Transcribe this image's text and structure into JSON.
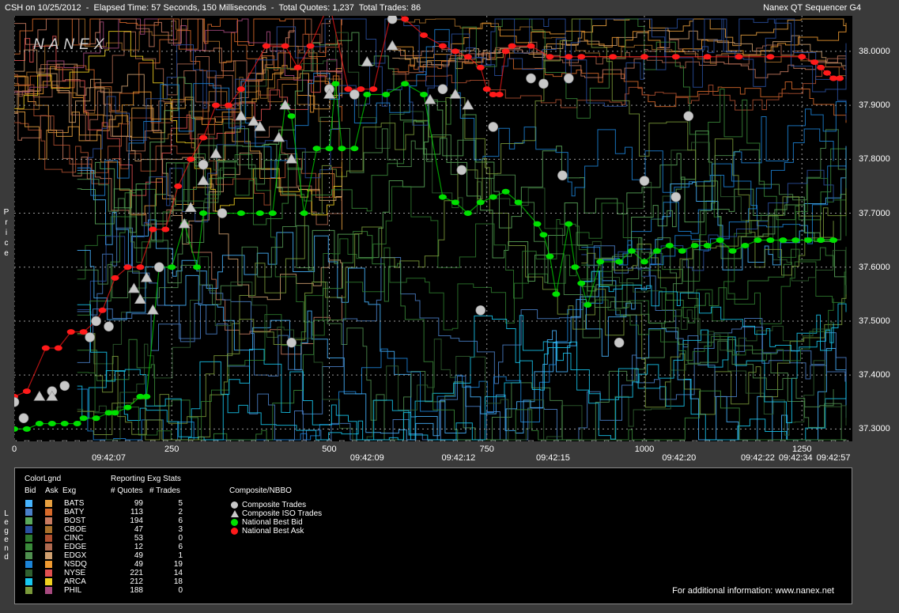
{
  "header": {
    "left": "CSH on 10/25/2012  -  Elapsed Time: 57 Seconds, 150 Milliseconds  -  Total Quotes: 1,237  Total Trades: 86",
    "right": "Nanex QT Sequencer G4",
    "logo": "NANEX",
    "y_axis_title": "Price",
    "legend_side_title": "Legend"
  },
  "chart_data": {
    "type": "scatter",
    "ylim": [
      37.28,
      38.06
    ],
    "xlim": [
      0,
      1320
    ],
    "y_ticks": [
      "37.3000",
      "37.4000",
      "37.5000",
      "37.6000",
      "37.7000",
      "37.8000",
      "37.9000",
      "38.0000"
    ],
    "x_ticks_numeric": [
      "0",
      "250",
      "500",
      "750",
      "1000",
      "1250"
    ],
    "x_ticks_time": [
      {
        "x": 150,
        "label": "09:42:07"
      },
      {
        "x": 560,
        "label": "09:42:09"
      },
      {
        "x": 705,
        "label": "09:42:12"
      },
      {
        "x": 855,
        "label": "09:42:15"
      },
      {
        "x": 1055,
        "label": "09:42:20"
      },
      {
        "x": 1180,
        "label": "09:42:22"
      },
      {
        "x": 1240,
        "label": "09:42:34"
      },
      {
        "x": 1300,
        "label": "09:42:57"
      }
    ],
    "grid": true,
    "series": [
      {
        "name": "National Best Bid",
        "color": "#00e000",
        "points": [
          [
            0,
            37.3
          ],
          [
            20,
            37.3
          ],
          [
            40,
            37.31
          ],
          [
            60,
            37.31
          ],
          [
            80,
            37.31
          ],
          [
            100,
            37.31
          ],
          [
            110,
            37.32
          ],
          [
            130,
            37.32
          ],
          [
            150,
            37.33
          ],
          [
            160,
            37.33
          ],
          [
            180,
            37.34
          ],
          [
            200,
            37.36
          ],
          [
            210,
            37.36
          ],
          [
            230,
            37.6
          ],
          [
            250,
            37.6
          ],
          [
            270,
            37.68
          ],
          [
            290,
            37.6
          ],
          [
            300,
            37.7
          ],
          [
            330,
            37.7
          ],
          [
            360,
            37.7
          ],
          [
            390,
            37.7
          ],
          [
            410,
            37.7
          ],
          [
            430,
            37.9
          ],
          [
            440,
            37.88
          ],
          [
            460,
            37.7
          ],
          [
            480,
            37.82
          ],
          [
            500,
            37.82
          ],
          [
            510,
            37.94
          ],
          [
            520,
            37.82
          ],
          [
            540,
            37.82
          ],
          [
            560,
            37.92
          ],
          [
            590,
            37.92
          ],
          [
            620,
            37.94
          ],
          [
            650,
            37.92
          ],
          [
            680,
            37.73
          ],
          [
            700,
            37.72
          ],
          [
            720,
            37.7
          ],
          [
            740,
            37.72
          ],
          [
            760,
            37.73
          ],
          [
            780,
            37.74
          ],
          [
            800,
            37.72
          ],
          [
            830,
            37.68
          ],
          [
            840,
            37.66
          ],
          [
            850,
            37.62
          ],
          [
            860,
            37.55
          ],
          [
            880,
            37.68
          ],
          [
            890,
            37.6
          ],
          [
            900,
            37.57
          ],
          [
            910,
            37.53
          ],
          [
            930,
            37.61
          ],
          [
            960,
            37.61
          ],
          [
            980,
            37.63
          ],
          [
            1000,
            37.61
          ],
          [
            1020,
            37.63
          ],
          [
            1040,
            37.64
          ],
          [
            1060,
            37.63
          ],
          [
            1080,
            37.64
          ],
          [
            1100,
            37.64
          ],
          [
            1120,
            37.65
          ],
          [
            1140,
            37.63
          ],
          [
            1160,
            37.64
          ],
          [
            1180,
            37.65
          ],
          [
            1200,
            37.65
          ],
          [
            1220,
            37.65
          ],
          [
            1240,
            37.65
          ],
          [
            1260,
            37.65
          ],
          [
            1280,
            37.65
          ],
          [
            1300,
            37.65
          ]
        ]
      },
      {
        "name": "National Best Ask",
        "color": "#ff1a1a",
        "points": [
          [
            0,
            37.36
          ],
          [
            20,
            37.37
          ],
          [
            50,
            37.45
          ],
          [
            70,
            37.45
          ],
          [
            90,
            37.48
          ],
          [
            110,
            37.48
          ],
          [
            130,
            37.5
          ],
          [
            140,
            37.52
          ],
          [
            160,
            37.58
          ],
          [
            180,
            37.6
          ],
          [
            200,
            37.6
          ],
          [
            220,
            37.67
          ],
          [
            240,
            37.67
          ],
          [
            260,
            37.75
          ],
          [
            280,
            37.8
          ],
          [
            300,
            37.84
          ],
          [
            320,
            37.9
          ],
          [
            340,
            37.9
          ],
          [
            360,
            37.93
          ],
          [
            400,
            38.01
          ],
          [
            430,
            38.01
          ],
          [
            450,
            37.97
          ],
          [
            470,
            38.01
          ],
          [
            500,
            38.09
          ],
          [
            530,
            37.93
          ],
          [
            550,
            37.93
          ],
          [
            570,
            37.93
          ],
          [
            600,
            38.08
          ],
          [
            620,
            38.06
          ],
          [
            650,
            38.03
          ],
          [
            680,
            38.01
          ],
          [
            700,
            38.0
          ],
          [
            720,
            37.99
          ],
          [
            740,
            37.97
          ],
          [
            750,
            37.93
          ],
          [
            760,
            37.92
          ],
          [
            770,
            37.92
          ],
          [
            780,
            38.0
          ],
          [
            790,
            38.01
          ],
          [
            820,
            38.01
          ],
          [
            850,
            37.99
          ],
          [
            880,
            37.99
          ],
          [
            900,
            37.99
          ],
          [
            950,
            37.99
          ],
          [
            1000,
            37.99
          ],
          [
            1050,
            37.99
          ],
          [
            1100,
            37.99
          ],
          [
            1150,
            37.99
          ],
          [
            1200,
            37.99
          ],
          [
            1250,
            37.99
          ],
          [
            1270,
            37.98
          ],
          [
            1280,
            37.97
          ],
          [
            1290,
            37.96
          ],
          [
            1300,
            37.95
          ],
          [
            1310,
            37.95
          ]
        ]
      },
      {
        "name": "Composite Trades",
        "color": "#c8c8c8",
        "points": [
          [
            0,
            37.35
          ],
          [
            15,
            37.32
          ],
          [
            60,
            37.37
          ],
          [
            80,
            37.38
          ],
          [
            120,
            37.47
          ],
          [
            130,
            37.5
          ],
          [
            150,
            37.49
          ],
          [
            230,
            37.6
          ],
          [
            300,
            37.79
          ],
          [
            330,
            37.7
          ],
          [
            440,
            37.46
          ],
          [
            500,
            37.93
          ],
          [
            540,
            37.92
          ],
          [
            570,
            38.08
          ],
          [
            600,
            38.06
          ],
          [
            640,
            38.08
          ],
          [
            680,
            37.93
          ],
          [
            710,
            37.78
          ],
          [
            740,
            37.52
          ],
          [
            760,
            37.86
          ],
          [
            820,
            37.95
          ],
          [
            840,
            37.94
          ],
          [
            870,
            37.77
          ],
          [
            880,
            37.95
          ],
          [
            960,
            37.46
          ],
          [
            1000,
            37.76
          ],
          [
            1050,
            37.73
          ],
          [
            1070,
            37.88
          ]
        ]
      },
      {
        "name": "Composite ISO Trades",
        "color": "#c8c8c8",
        "points": [
          [
            40,
            37.36
          ],
          [
            60,
            37.36
          ],
          [
            190,
            37.56
          ],
          [
            200,
            37.54
          ],
          [
            210,
            37.58
          ],
          [
            220,
            37.52
          ],
          [
            270,
            37.68
          ],
          [
            280,
            37.71
          ],
          [
            300,
            37.76
          ],
          [
            320,
            37.81
          ],
          [
            360,
            37.88
          ],
          [
            380,
            37.87
          ],
          [
            390,
            37.86
          ],
          [
            420,
            37.84
          ],
          [
            430,
            37.9
          ],
          [
            440,
            37.8
          ],
          [
            500,
            37.92
          ],
          [
            560,
            37.98
          ],
          [
            600,
            38.01
          ],
          [
            660,
            37.91
          ],
          [
            700,
            37.92
          ],
          [
            720,
            37.9
          ]
        ]
      }
    ]
  },
  "legend": {
    "color_legend_label": "ColorLgnd",
    "reporting_label": "Reporting Exg Stats",
    "composite_label": "Composite/NBBO",
    "col_bid": "Bid",
    "col_ask": "Ask",
    "col_exg": "Exg",
    "col_quotes": "# Quotes",
    "col_trades": "# Trades",
    "rows": [
      {
        "exg": "BATS",
        "quotes": "99",
        "trades": "5",
        "bid": "#46b4ff",
        "ask": "#e8a040"
      },
      {
        "exg": "BATY",
        "quotes": "113",
        "trades": "2",
        "bid": "#4a80c8",
        "ask": "#d86a2a"
      },
      {
        "exg": "BOST",
        "quotes": "194",
        "trades": "6",
        "bid": "#5aa85a",
        "ask": "#c87a60"
      },
      {
        "exg": "CBOE",
        "quotes": "47",
        "trades": "3",
        "bid": "#2a50a0",
        "ask": "#a8702a"
      },
      {
        "exg": "CINC",
        "quotes": "53",
        "trades": "0",
        "bid": "#2e7a2e",
        "ask": "#b05030"
      },
      {
        "exg": "EDGE",
        "quotes": "12",
        "trades": "6",
        "bid": "#3a8a3a",
        "ask": "#b06a50"
      },
      {
        "exg": "EDGX",
        "quotes": "49",
        "trades": "1",
        "bid": "#509050",
        "ask": "#d0a070"
      },
      {
        "exg": "NSDQ",
        "quotes": "49",
        "trades": "19",
        "bid": "#1c84d8",
        "ask": "#f09a30"
      },
      {
        "exg": "NYSE",
        "quotes": "221",
        "trades": "14",
        "bid": "#306030",
        "ask": "#e05050"
      },
      {
        "exg": "ARCA",
        "quotes": "212",
        "trades": "18",
        "bid": "#18c8f0",
        "ask": "#f0d020"
      },
      {
        "exg": "PHIL",
        "quotes": "188",
        "trades": "0",
        "bid": "#7a9a3a",
        "ask": "#a84a80"
      }
    ],
    "composite_items": [
      {
        "label": "Composite Trades",
        "icon": "circle",
        "color": "#c8c8c8"
      },
      {
        "label": "Composite ISO Trades",
        "icon": "triangle",
        "color": "#c8c8c8"
      },
      {
        "label": "National Best Bid",
        "icon": "circle",
        "color": "#00e000"
      },
      {
        "label": "National Best Ask",
        "icon": "circle",
        "color": "#ff1a1a"
      }
    ],
    "footer_note": "For additional information: www.nanex.net"
  }
}
